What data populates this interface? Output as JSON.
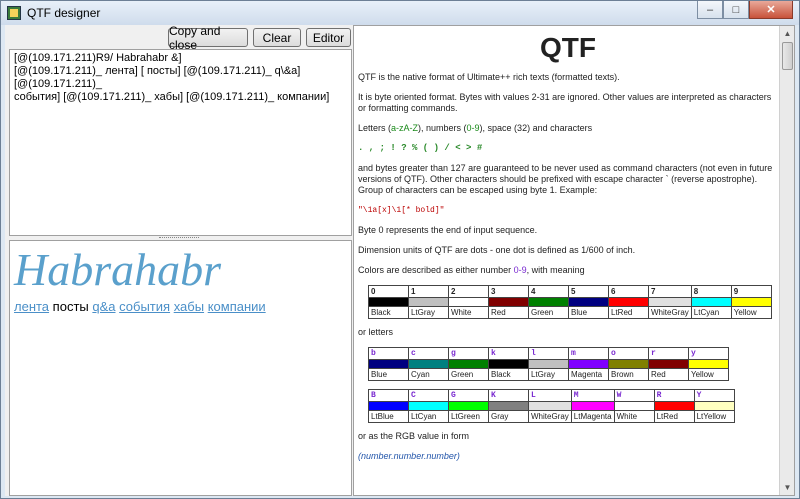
{
  "window": {
    "title": "QTF designer",
    "min": "–",
    "max": "□",
    "close": "✕"
  },
  "toolbar": {
    "copy_label": "Copy and close",
    "clear_label": "Clear",
    "editor_label": "Editor"
  },
  "code": {
    "line1": "[@(109.171.211)R9/ Habrahabr &]",
    "line2": "[@(109.171.211)_ лента] [ посты] [@(109.171.211)_ q\\&a] [@(109.171.211)_",
    "line3": "события] [@(109.171.211)_ хабы] [@(109.171.211)_ компании]"
  },
  "preview": {
    "title": "Habrahabr",
    "nav": [
      {
        "label": "лента",
        "current": false
      },
      {
        "label": "посты",
        "current": true
      },
      {
        "label": "q&a",
        "current": false
      },
      {
        "label": "события",
        "current": false
      },
      {
        "label": "хабы",
        "current": false
      },
      {
        "label": "компании",
        "current": false
      }
    ]
  },
  "doc": {
    "title": "QTF",
    "p1": "QTF is the native format of Ultimate++ rich texts (formatted texts).",
    "p2": "It is byte oriented format. Bytes with values 2-31 are ignored. Other values are interpreted as characters or formatting commands.",
    "p3a": "Letters (",
    "p3b": "a-zA-Z",
    "p3c": "), numbers (",
    "p3d": "0-9",
    "p3e": "), space (32) and characters",
    "chars": ". , ; ! ? % ( ) / < > #",
    "p4": "and bytes greater than 127 are guaranteed to be never used as command characters (not even in future versions of QTF). Other characters should be prefixed with escape character ` (reverse apostrophe). Group of characters can be escaped using byte 1. Example:",
    "example": "\"\\1a[x]\\1[* bold]\"",
    "p5": "Byte 0 represents the end of input sequence.",
    "p6": "Dimension units of QTF are dots - one dot is defined as 1/600 of inch.",
    "p7a": "Colors are described as either number ",
    "p7b": "0-9",
    "p7c": ", with meaning",
    "p8": "or letters",
    "p9": "or as the RGB value in form",
    "rgb": "(number.number.number)"
  },
  "color_tables": {
    "numbers": [
      {
        "key": "0",
        "name": "Black",
        "hex": "#000000"
      },
      {
        "key": "1",
        "name": "LtGray",
        "hex": "#c0c0c0"
      },
      {
        "key": "2",
        "name": "White",
        "hex": "#ffffff"
      },
      {
        "key": "3",
        "name": "Red",
        "hex": "#800000"
      },
      {
        "key": "4",
        "name": "Green",
        "hex": "#008000"
      },
      {
        "key": "5",
        "name": "Blue",
        "hex": "#000080"
      },
      {
        "key": "6",
        "name": "LtRed",
        "hex": "#ff0000"
      },
      {
        "key": "7",
        "name": "WhiteGray",
        "hex": "#e0e0e0"
      },
      {
        "key": "8",
        "name": "LtCyan",
        "hex": "#00ffff"
      },
      {
        "key": "9",
        "name": "Yellow",
        "hex": "#ffff00"
      }
    ],
    "letters1": [
      {
        "key": "b",
        "name": "Blue",
        "hex": "#000080"
      },
      {
        "key": "c",
        "name": "Cyan",
        "hex": "#008080"
      },
      {
        "key": "g",
        "name": "Green",
        "hex": "#008000"
      },
      {
        "key": "k",
        "name": "Black",
        "hex": "#000000"
      },
      {
        "key": "l",
        "name": "LtGray",
        "hex": "#c0c0c0"
      },
      {
        "key": "m",
        "name": "Magenta",
        "hex": "#8000ff"
      },
      {
        "key": "o",
        "name": "Brown",
        "hex": "#808000"
      },
      {
        "key": "r",
        "name": "Red",
        "hex": "#800000"
      },
      {
        "key": "y",
        "name": "Yellow",
        "hex": "#ffff00"
      }
    ],
    "letters2": [
      {
        "key": "B",
        "name": "LtBlue",
        "hex": "#0000ff"
      },
      {
        "key": "C",
        "name": "LtCyan",
        "hex": "#00ffff"
      },
      {
        "key": "G",
        "name": "LtGreen",
        "hex": "#00ff00"
      },
      {
        "key": "K",
        "name": "Gray",
        "hex": "#808080"
      },
      {
        "key": "L",
        "name": "WhiteGray",
        "hex": "#e0e0e0"
      },
      {
        "key": "M",
        "name": "LtMagenta",
        "hex": "#ff00ff"
      },
      {
        "key": "W",
        "name": "White",
        "hex": "#ffffff"
      },
      {
        "key": "R",
        "name": "LtRed",
        "hex": "#ff0000"
      },
      {
        "key": "Y",
        "name": "LtYellow",
        "hex": "#ffffc0"
      }
    ]
  }
}
